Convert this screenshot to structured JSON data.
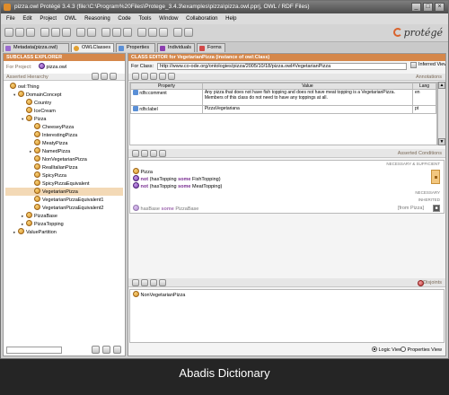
{
  "window": {
    "title": "pizza.owl  Protégé 3.4.3   (file:\\C:\\Program%20Files\\Protege_3.4.3\\examples\\pizza\\pizza.owl.pprj, OWL / RDF Files)",
    "minimize": "_",
    "maximize": "□",
    "close": "×"
  },
  "menu": [
    "File",
    "Edit",
    "Project",
    "OWL",
    "Reasoning",
    "Code",
    "Tools",
    "Window",
    "Collaboration",
    "Help"
  ],
  "logo_text": "protégé",
  "tabs": [
    {
      "label": "Metadata(pizza.owl)",
      "color": "#9b6bd0"
    },
    {
      "label": "OWLClasses",
      "color": "#e2a030"
    },
    {
      "label": "Properties",
      "color": "#5a8fd6"
    },
    {
      "label": "Individuals",
      "color": "#8c3fb0"
    },
    {
      "label": "Forms",
      "color": "#d24a4a"
    }
  ],
  "left": {
    "header": "SUBCLASS EXPLORER",
    "for_project_label": "For Project:",
    "for_project_value": "pizza.owl",
    "hierarchy_label": "Asserted Hierarchy",
    "tree": [
      {
        "label": "owl:Thing",
        "depth": 0,
        "toggle": "",
        "icon": "org"
      },
      {
        "label": "DomainConcept",
        "depth": 1,
        "toggle": "▾",
        "icon": "org"
      },
      {
        "label": "Country",
        "depth": 2,
        "toggle": "",
        "icon": "org"
      },
      {
        "label": "IceCream",
        "depth": 2,
        "toggle": "",
        "icon": "org"
      },
      {
        "label": "Pizza",
        "depth": 2,
        "toggle": "▾",
        "icon": "org"
      },
      {
        "label": "CheeseyPizza",
        "depth": 3,
        "toggle": "",
        "icon": "org"
      },
      {
        "label": "InterestingPizza",
        "depth": 3,
        "toggle": "",
        "icon": "org"
      },
      {
        "label": "MeatyPizza",
        "depth": 3,
        "toggle": "",
        "icon": "org"
      },
      {
        "label": "NamedPizza",
        "depth": 3,
        "toggle": "▸",
        "icon": "org"
      },
      {
        "label": "NonVegetarianPizza",
        "depth": 3,
        "toggle": "",
        "icon": "org"
      },
      {
        "label": "RealItalianPizza",
        "depth": 3,
        "toggle": "",
        "icon": "org"
      },
      {
        "label": "SpicyPizza",
        "depth": 3,
        "toggle": "",
        "icon": "org"
      },
      {
        "label": "SpicyPizzaEquivalent",
        "depth": 3,
        "toggle": "",
        "icon": "org"
      },
      {
        "label": "VegetarianPizza",
        "depth": 3,
        "toggle": "",
        "icon": "org",
        "selected": true
      },
      {
        "label": "VegetarianPizzaEquivalent1",
        "depth": 3,
        "toggle": "",
        "icon": "org"
      },
      {
        "label": "VegetarianPizzaEquivalent2",
        "depth": 3,
        "toggle": "",
        "icon": "org"
      },
      {
        "label": "PizzaBase",
        "depth": 2,
        "toggle": "▸",
        "icon": "org"
      },
      {
        "label": "PizzaTopping",
        "depth": 2,
        "toggle": "▸",
        "icon": "org"
      },
      {
        "label": "ValuePartition",
        "depth": 1,
        "toggle": "▸",
        "icon": "org"
      }
    ]
  },
  "editor": {
    "header": "CLASS EDITOR for VegetarianPizza   (instance of owl:Class)",
    "for_class_label": "For Class:",
    "for_class_value": "http://www.co-ode.org/ontologies/pizza/2005/10/18/pizza.owl#VegetarianPizza",
    "inferred_view_label": "Inferred View",
    "annotations_label": "Annotations",
    "columns": [
      "Property",
      "Value",
      "Lang"
    ],
    "rows": [
      {
        "property": "rdfs:comment",
        "value": "Any pizza that does not have fish topping and does not have meat topping is a VegetarianPizza. Members of this class do not need to have any toppings at all.",
        "lang": "en"
      },
      {
        "property": "rdfs:label",
        "value": "PizzaVegetariana",
        "lang": "pt"
      }
    ]
  },
  "conditions": {
    "label": "Asserted Conditions",
    "necessary_sufficient": "NECESSARY & SUFFICIENT",
    "necessary": "NECESSARY",
    "inherited": "INHERITED",
    "items": [
      {
        "text": "Pizza",
        "icon": "org"
      },
      {
        "prefix": "not",
        "text": "(hasTopping",
        "kw": "some",
        "rest": "FishTopping)",
        "icon": "purple"
      },
      {
        "prefix": "not",
        "text": "(hasTopping",
        "kw": "some",
        "rest": "MeatTopping)",
        "icon": "purple"
      }
    ],
    "inherited_item": {
      "text": "hasBase",
      "kw": "some",
      "rest": "PizzaBase",
      "from": "[from Pizza]"
    }
  },
  "disjoints": {
    "label": "Disjoints",
    "items": [
      "NonVegetarianPizza"
    ]
  },
  "views": {
    "logic": "Logic View",
    "properties": "Properties View"
  },
  "caption": "Abadis Dictionary"
}
